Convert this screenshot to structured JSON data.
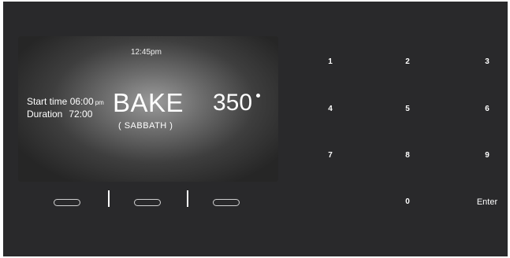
{
  "display": {
    "time": "12:45pm",
    "start_label": "Start time",
    "start_value": "06:00",
    "start_unit": "pm",
    "duration_label": "Duration",
    "duration_value": "72:00",
    "mode": "BAKE",
    "submode": "( SABBATH )",
    "temperature": "350"
  },
  "soft_keys": 3,
  "keypad": {
    "k1": "1",
    "k2": "2",
    "k3": "3",
    "k4": "4",
    "k5": "5",
    "k6": "6",
    "k7": "7",
    "k8": "8",
    "k9": "9",
    "k0": "0",
    "enter": "Enter"
  },
  "colors": {
    "panel": "#29292b",
    "text": "#ffffff"
  }
}
